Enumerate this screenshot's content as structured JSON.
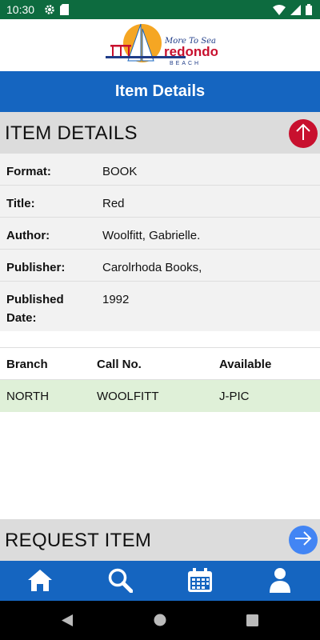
{
  "status_bar": {
    "time": "10:30"
  },
  "logo": {
    "tagline": "More To Sea",
    "name": "redondo",
    "sub": "BEACH"
  },
  "title_bar": {
    "title": "Item Details"
  },
  "item_details": {
    "header": "ITEM DETAILS",
    "fields": [
      {
        "label": "Format:",
        "value": "BOOK"
      },
      {
        "label": "Title:",
        "value": "Red"
      },
      {
        "label": "Author:",
        "value": "Woolfitt, Gabrielle."
      },
      {
        "label": "Publisher:",
        "value": "Carolrhoda Books,"
      },
      {
        "label": "Published Date:",
        "value": "1992"
      }
    ]
  },
  "holdings": {
    "columns": [
      "Branch",
      "Call No.",
      "Available"
    ],
    "rows": [
      {
        "branch": "NORTH",
        "call_no": "WOOLFITT",
        "available": "J-PIC"
      }
    ]
  },
  "request": {
    "header": "REQUEST ITEM"
  },
  "colors": {
    "status_bar": "#0d6b3f",
    "primary": "#1565c0",
    "scroll_up_button": "#c8102e",
    "request_button": "#4285f4",
    "available_row": "#dff0d8"
  }
}
